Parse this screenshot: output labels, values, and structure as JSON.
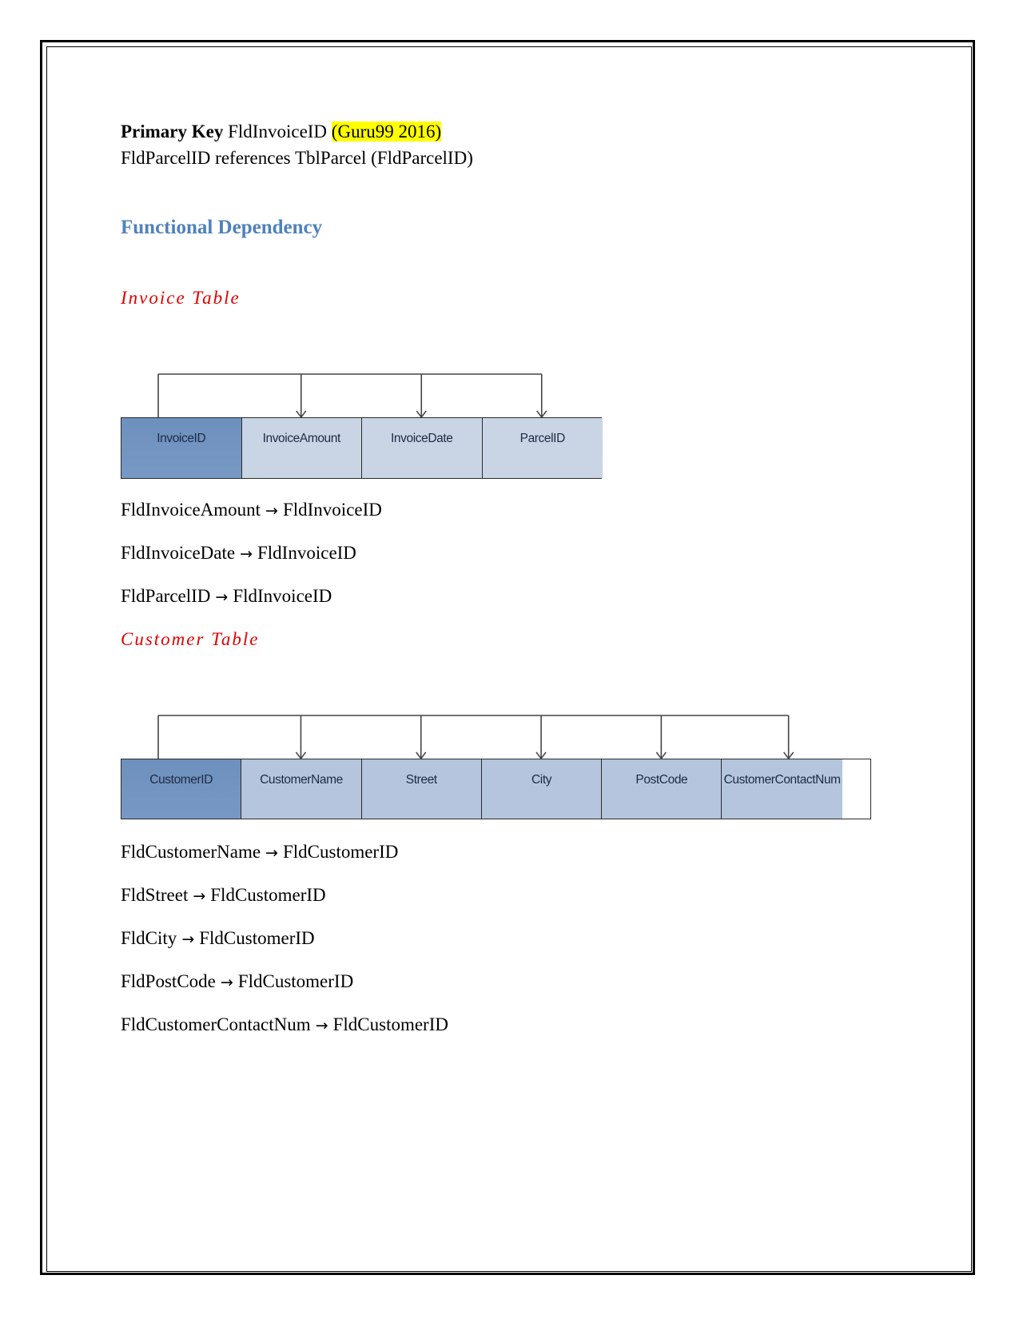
{
  "document": {
    "primary_key_line": {
      "label": "Primary Key",
      "value": "FldInvoiceID",
      "citation": "(Guru99 2016)"
    },
    "foreign_key_line": "FldParcelID references TblParcel (FldParcelID)",
    "section_heading": "Functional Dependency",
    "colors": {
      "heading": "#4f81bd",
      "subheading": "#e00000",
      "highlight": "#ffff00",
      "key_cell": "#7193bf",
      "nonkey_cell": "#b4c5dd"
    },
    "invoice": {
      "title": "Invoice Table",
      "diagram_cells": [
        "InvoiceID",
        "InvoiceAmount",
        "InvoiceDate",
        "ParcelID"
      ],
      "key_index": 0,
      "dependencies": [
        {
          "from": "FldInvoiceAmount",
          "arrow": "→",
          "to": "FldInvoiceID"
        },
        {
          "from": "FldInvoiceDate",
          "arrow": "→",
          "to": "FldInvoiceID"
        },
        {
          "from": "FldParcelID",
          "arrow": "→",
          "to": "FldInvoiceID"
        }
      ]
    },
    "customer": {
      "title": "Customer Table",
      "diagram_cells": [
        "CustomerID",
        "CustomerName",
        "Street",
        "City",
        "PostCode",
        "CustomerContactNum"
      ],
      "key_index": 0,
      "dependencies": [
        {
          "from": "FldCustomerName",
          "arrow": "→",
          "to": "FldCustomerID"
        },
        {
          "from": "FldStreet",
          "arrow": "→",
          "to": "FldCustomerID"
        },
        {
          "from": "FldCity",
          "arrow": "→",
          "to": "FldCustomerID"
        },
        {
          "from": "FldPostCode",
          "arrow": "→",
          "to": "FldCustomerID"
        },
        {
          "from": "FldCustomerContactNum",
          "arrow": "→",
          "to": "FldCustomerID"
        }
      ]
    }
  }
}
